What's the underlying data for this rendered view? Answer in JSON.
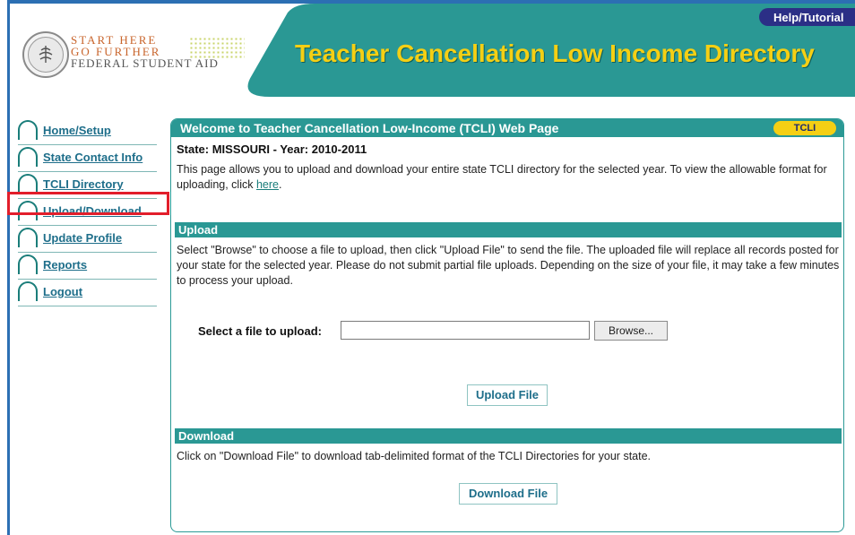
{
  "header": {
    "logo": {
      "line1": "START HERE",
      "line2": "GO FURTHER",
      "line3": "FEDERAL STUDENT AID"
    },
    "app_title": "Teacher Cancellation Low Income Directory",
    "help_label": "Help/Tutorial"
  },
  "sidebar": {
    "items": [
      {
        "label": "Home/Setup"
      },
      {
        "label": "State Contact Info"
      },
      {
        "label": "TCLI Directory"
      },
      {
        "label": "Upload/Download"
      },
      {
        "label": "Update Profile"
      },
      {
        "label": "Reports"
      },
      {
        "label": "Logout"
      }
    ],
    "highlighted": "Upload/Download"
  },
  "panel": {
    "title": "Welcome to Teacher Cancellation Low-Income (TCLI) Web Page",
    "badge": "TCLI",
    "state_line": "State: MISSOURI - Year: 2010-2011",
    "intro_text": "This page allows you to upload and download your entire state TCLI directory for the selected year. To view the allowable format for uploading, click ",
    "intro_link": "here",
    "intro_end": "."
  },
  "upload": {
    "heading": "Upload",
    "text": "Select \"Browse\" to choose a file to upload, then click \"Upload File\" to send the file. The uploaded file will replace all records posted for your state for the selected year. Please do not submit partial file uploads. Depending on the size of your file, it may take a few minutes to process your upload.",
    "file_label": "Select a file to upload:",
    "file_value": "",
    "browse_label": "Browse...",
    "upload_button": "Upload File"
  },
  "download": {
    "heading": "Download",
    "text": "Click on \"Download File\" to download tab-delimited format of the TCLI Directories for your state.",
    "download_button": "Download File"
  },
  "colors": {
    "teal": "#2a9894",
    "title_yellow": "#f5cf14",
    "help_navy": "#2b2f86",
    "highlight_red": "#e21e2b",
    "frame_blue": "#2c6fb3"
  }
}
